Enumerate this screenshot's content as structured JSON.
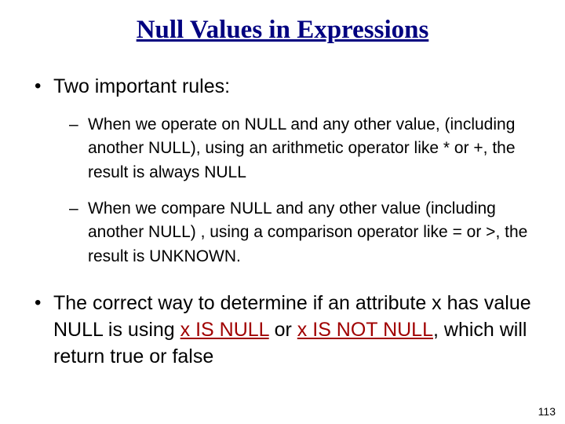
{
  "title": "Null Values in Expressions",
  "bullets": {
    "b1_intro": "Two important rules:",
    "b1_sub1": "When we operate on NULL and any other value, (including another NULL), using an arithmetic operator like * or +, the result is always NULL",
    "b1_sub2": "When we compare NULL and any other value (including another NULL) , using a comparison operator like = or >, the result is UNKNOWN.",
    "b2_pre": "The correct way to determine if an attribute x has value NULL is using ",
    "b2_kw1": "x IS NULL",
    "b2_mid": " or ",
    "b2_kw2": "x IS NOT NULL",
    "b2_post": ", which will return true or false"
  },
  "page_number": "113"
}
